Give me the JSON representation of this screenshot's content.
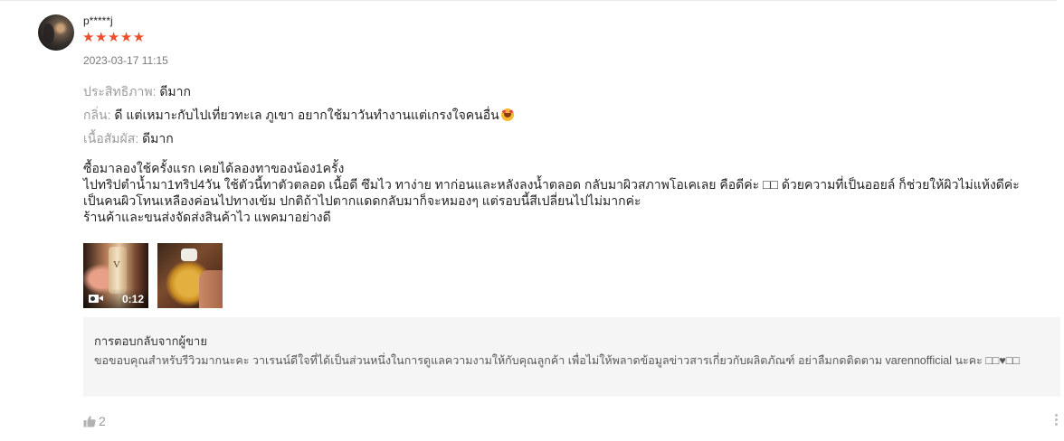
{
  "review": {
    "username": "p*****j",
    "stars": "★★★★★",
    "rating": 5,
    "datetime": "2023-03-17 11:15",
    "attributes": [
      {
        "key": "ประสิทธิภาพ: ",
        "value": "ดีมาก"
      },
      {
        "key": "กลิ่น: ",
        "value": "ดี แต่เหมาะกับไปเที่ยวทะเล ภูเขา อยากใช้มาวันทำงานแต่เกรงใจคนอื่น"
      },
      {
        "key": "เนื้อสัมผัส: ",
        "value": "ดีมาก"
      }
    ],
    "body_lines": [
      "ซื้อมาลองใช้ครั้งแรก เคยได้ลองทาของน้อง1ครั้ง",
      "ไปทริปตำน้ำมา1ทริป4วัน ใช้ตัวนี้ทาตัวตลอด เนื้อดี ซึมไว ทาง่าย ทาก่อนและหลังลงน้ำตลอด กลับมาผิวสภาพโอเคเลย คือดีค่ะ □□ ด้วยความที่เป็นออยล์ ก็ช่วยให้ผิวไม่แห้งดีค่ะ",
      "เป็นคนผิวโทนเหลืองค่อนไปทางเข้ม ปกติถ้าไปตากแดดกลับมาก็จะหมองๆ แต่รอบนี้สีเปลี่ยนไปไม่มากค่ะ",
      "ร้านค้าและขนส่งจัดส่งสินค้าไว แพคมาอย่างดี"
    ],
    "media": {
      "video_duration": "0:12"
    },
    "seller_reply": {
      "title": "การตอบกลับจากผู้ขาย",
      "text": "ขอขอบคุณสำหรับรีวิวมากนะคะ วาเรนน์ดีใจที่ได้เป็นส่วนหนึ่งในการดูแลความงามให้กับคุณลูกค้า เพื่อไม่ให้พลาดข้อมูลข่าวสารเกี่ยวกับผลิตภัณฑ์ อย่าลืมกดติดตาม varennofficial นะคะ □□♥□□"
    },
    "likes": "2"
  },
  "colors": {
    "star": "#ee4d2d",
    "reply_background": "#f5f5f5"
  },
  "icons": {
    "like": "thumb-up-icon",
    "more": "more-vertical-icon",
    "video": "video-camera-icon",
    "emoji": "smiling-face-with-hearts-emoji"
  }
}
